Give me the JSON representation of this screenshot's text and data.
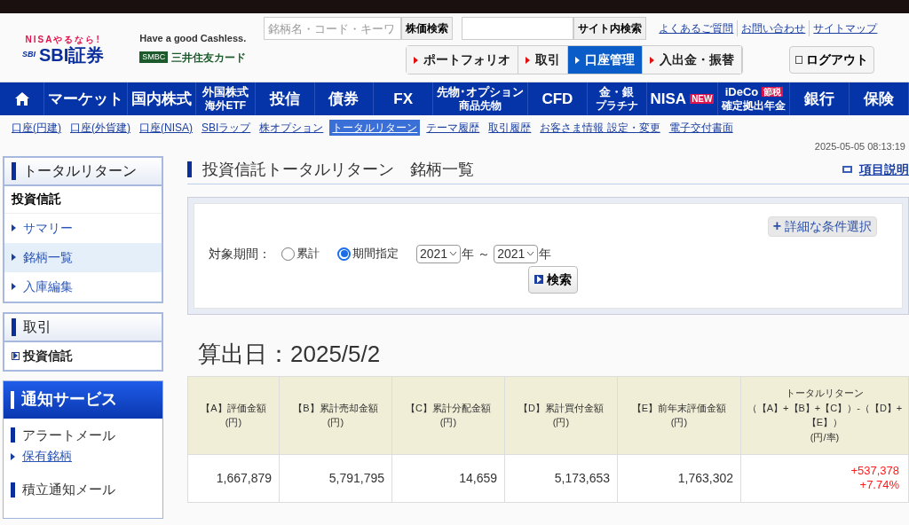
{
  "header": {
    "logo": {
      "tagline": "NISAやるなら!",
      "name": "SBI証券",
      "group": "SBI"
    },
    "ad": {
      "slogan": "Have a good Cashless.",
      "bank": "SMBC",
      "card": "三井住友カード"
    },
    "stock_search": {
      "placeholder": "銘柄名・コード・キーワ",
      "button": "株価検索"
    },
    "site_search": {
      "button": "サイト内検索"
    },
    "links": [
      "よくあるご質問",
      "お問い合わせ",
      "サイトマップ"
    ],
    "tabs": [
      {
        "label": "ポートフォリオ",
        "selected": false
      },
      {
        "label": "取引",
        "selected": false
      },
      {
        "label": "口座管理",
        "selected": true
      },
      {
        "label": "入出金・振替",
        "selected": false
      }
    ],
    "logout": "ログアウト"
  },
  "nav": [
    {
      "kind": "home"
    },
    {
      "kind": "text",
      "label": "マーケット"
    },
    {
      "kind": "text",
      "label": "国内株式"
    },
    {
      "kind": "text",
      "label": "外国株式",
      "sublabel": "海外ETF"
    },
    {
      "kind": "text",
      "label": "投信"
    },
    {
      "kind": "text",
      "label": "債券"
    },
    {
      "kind": "text",
      "label": "FX"
    },
    {
      "kind": "text",
      "label": "先物･オプション",
      "sublabel": "商品先物"
    },
    {
      "kind": "text",
      "label": "CFD"
    },
    {
      "kind": "text",
      "label": "金・銀",
      "sublabel": "プラチナ"
    },
    {
      "kind": "text",
      "label": "NISA",
      "badge": "NEW"
    },
    {
      "kind": "text",
      "label": "iDeCo",
      "badge": "節税",
      "sublabel": "確定拠出年金"
    },
    {
      "kind": "text",
      "label": "銀行"
    },
    {
      "kind": "text",
      "label": "保険"
    }
  ],
  "subnav": [
    {
      "label": "口座(円建)",
      "selected": false
    },
    {
      "label": "口座(外貨建)",
      "selected": false
    },
    {
      "label": "口座(NISA)",
      "selected": false
    },
    {
      "label": "SBIラップ",
      "selected": false
    },
    {
      "label": "株オプション",
      "selected": false
    },
    {
      "label": "トータルリターン",
      "selected": true
    },
    {
      "label": "テーマ履歴",
      "selected": false
    },
    {
      "label": "取引履歴",
      "selected": false
    },
    {
      "label": "お客さま情報 設定・変更",
      "selected": false
    },
    {
      "label": "電子交付書面",
      "selected": false
    }
  ],
  "timestamp": "2025-05-05 08:13:19",
  "sidebar": [
    {
      "title": "トータルリターン",
      "heading": "投資信託",
      "items": [
        {
          "label": "サマリー",
          "selected": false
        },
        {
          "label": "銘柄一覧",
          "selected": true
        },
        {
          "label": "入庫編集",
          "selected": false
        }
      ]
    },
    {
      "title": "取引",
      "items": [
        {
          "label": "投資信託",
          "selected": false,
          "kind": "box"
        }
      ]
    },
    {
      "title": "通知サービス",
      "kind": "notify",
      "groups": [
        {
          "title": "アラートメール",
          "links": [
            "保有銘柄"
          ]
        },
        {
          "title": "積立通知メール"
        }
      ]
    }
  ],
  "page": {
    "title": "投資信託トータルリターン　銘柄一覧",
    "help_link": "項目説明",
    "filter": {
      "advanced_icon": "+",
      "advanced": "詳細な条件選択",
      "label": "対象期間：",
      "options": [
        {
          "label": "累計",
          "selected": false
        },
        {
          "label": "期間指定",
          "selected": true
        }
      ],
      "from": "2021",
      "from_unit": "年",
      "separator": "～",
      "to": "2021",
      "to_unit": "年",
      "search": "検索"
    },
    "calc_date": "算出日：2025/5/2",
    "table": {
      "columns": [
        {
          "title": "【A】評価金額",
          "unit": "(円)"
        },
        {
          "title": "【B】累計売却金額",
          "unit": "(円)"
        },
        {
          "title": "【C】累計分配金額",
          "unit": "(円)"
        },
        {
          "title": "【D】累計買付金額",
          "unit": "(円)"
        },
        {
          "title": "【E】前年末評価金額",
          "unit": "(円)"
        },
        {
          "title": "トータルリターン",
          "formula": "（【A】+【B】+【C】）-（【D】+【E】）",
          "unit": "(円/率)"
        }
      ],
      "rows": [
        {
          "cells": [
            "1,667,879",
            "5,791,795",
            "14,659",
            "5,173,653",
            "1,763,302"
          ],
          "return_amount": "+537,378",
          "return_rate": "+7.74%",
          "positive": true
        }
      ]
    }
  }
}
